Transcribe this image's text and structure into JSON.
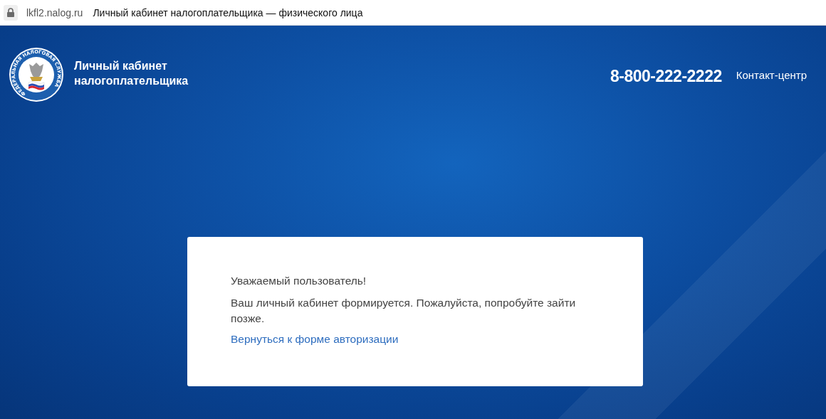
{
  "address_bar": {
    "url": "lkfl2.nalog.ru",
    "page_title": "Личный кабинет налогоплательщика — физического лица"
  },
  "header": {
    "logo_ring_text": "ФЕДЕРАЛЬНАЯ НАЛОГОВАЯ СЛУЖБА",
    "site_title_lines": [
      "Личный кабинет",
      "налогоплательщика"
    ],
    "phone": "8-800-222-2222",
    "contact_link": "Контакт-центр"
  },
  "message": {
    "greeting": "Уважаемый пользователь!",
    "text": "Ваш личный кабинет формируется. Пожалуйста, попробуйте зайти позже.",
    "link": "Вернуться к форме авторизации"
  }
}
